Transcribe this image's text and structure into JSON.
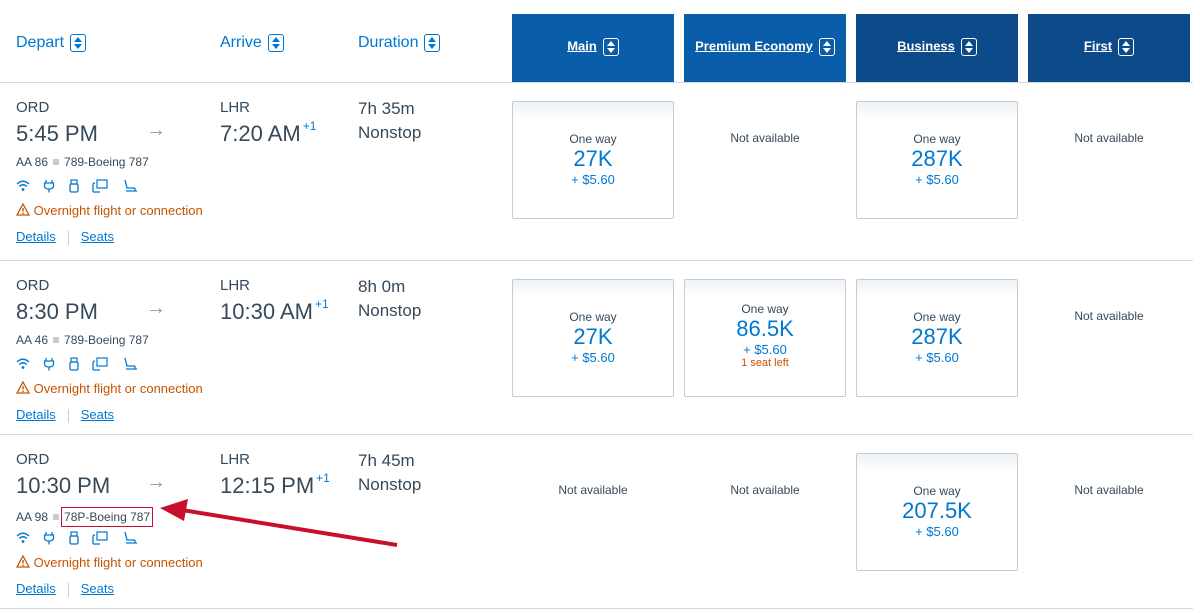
{
  "header": {
    "depart": "Depart",
    "arrive": "Arrive",
    "duration": "Duration",
    "cabins": [
      "Main",
      "Premium Economy",
      "Business",
      "First"
    ]
  },
  "flights": [
    {
      "origin": "ORD",
      "depart_time": "5:45 PM",
      "dest": "LHR",
      "arrive_time": "7:20 AM",
      "day_offset": "+1",
      "duration": "7h 35m",
      "stops": "Nonstop",
      "flight_number": "AA 86",
      "aircraft": "789-Boeing 787",
      "warning": "Overnight flight or connection",
      "details": "Details",
      "seats_link": "Seats",
      "fares": [
        {
          "available": true,
          "label": "One way",
          "miles": "27K",
          "tax": "+ $5.60"
        },
        {
          "available": false,
          "label": "Not available"
        },
        {
          "available": true,
          "label": "One way",
          "miles": "287K",
          "tax": "+ $5.60"
        },
        {
          "available": false,
          "label": "Not available"
        }
      ]
    },
    {
      "origin": "ORD",
      "depart_time": "8:30 PM",
      "dest": "LHR",
      "arrive_time": "10:30 AM",
      "day_offset": "+1",
      "duration": "8h 0m",
      "stops": "Nonstop",
      "flight_number": "AA 46",
      "aircraft": "789-Boeing 787",
      "warning": "Overnight flight or connection",
      "details": "Details",
      "seats_link": "Seats",
      "fares": [
        {
          "available": true,
          "label": "One way",
          "miles": "27K",
          "tax": "+ $5.60"
        },
        {
          "available": true,
          "label": "One way",
          "miles": "86.5K",
          "tax": "+ $5.60",
          "seats_left": "1 seat left"
        },
        {
          "available": true,
          "label": "One way",
          "miles": "287K",
          "tax": "+ $5.60"
        },
        {
          "available": false,
          "label": "Not available"
        }
      ]
    },
    {
      "origin": "ORD",
      "depart_time": "10:30 PM",
      "dest": "LHR",
      "arrive_time": "12:15 PM",
      "day_offset": "+1",
      "duration": "7h 45m",
      "stops": "Nonstop",
      "flight_number": "AA 98",
      "aircraft": "78P-Boeing 787",
      "warning": "Overnight flight or connection",
      "details": "Details",
      "seats_link": "Seats",
      "fares": [
        {
          "available": false,
          "label": "Not available"
        },
        {
          "available": false,
          "label": "Not available"
        },
        {
          "available": true,
          "label": "One way",
          "miles": "207.5K",
          "tax": "+ $5.60"
        },
        {
          "available": false,
          "label": "Not available"
        }
      ]
    }
  ],
  "icons": [
    "wifi-icon",
    "power-outlet-icon",
    "usb-icon",
    "entertainment-icon",
    "lie-flat-seat-icon",
    "warning-icon",
    "arrow-right-icon"
  ],
  "colors": {
    "link": "#0078d2",
    "header_main": "#0a5ea9",
    "header_dark": "#0d4a8a",
    "warning": "#c75300",
    "annotation": "#c8102e"
  }
}
